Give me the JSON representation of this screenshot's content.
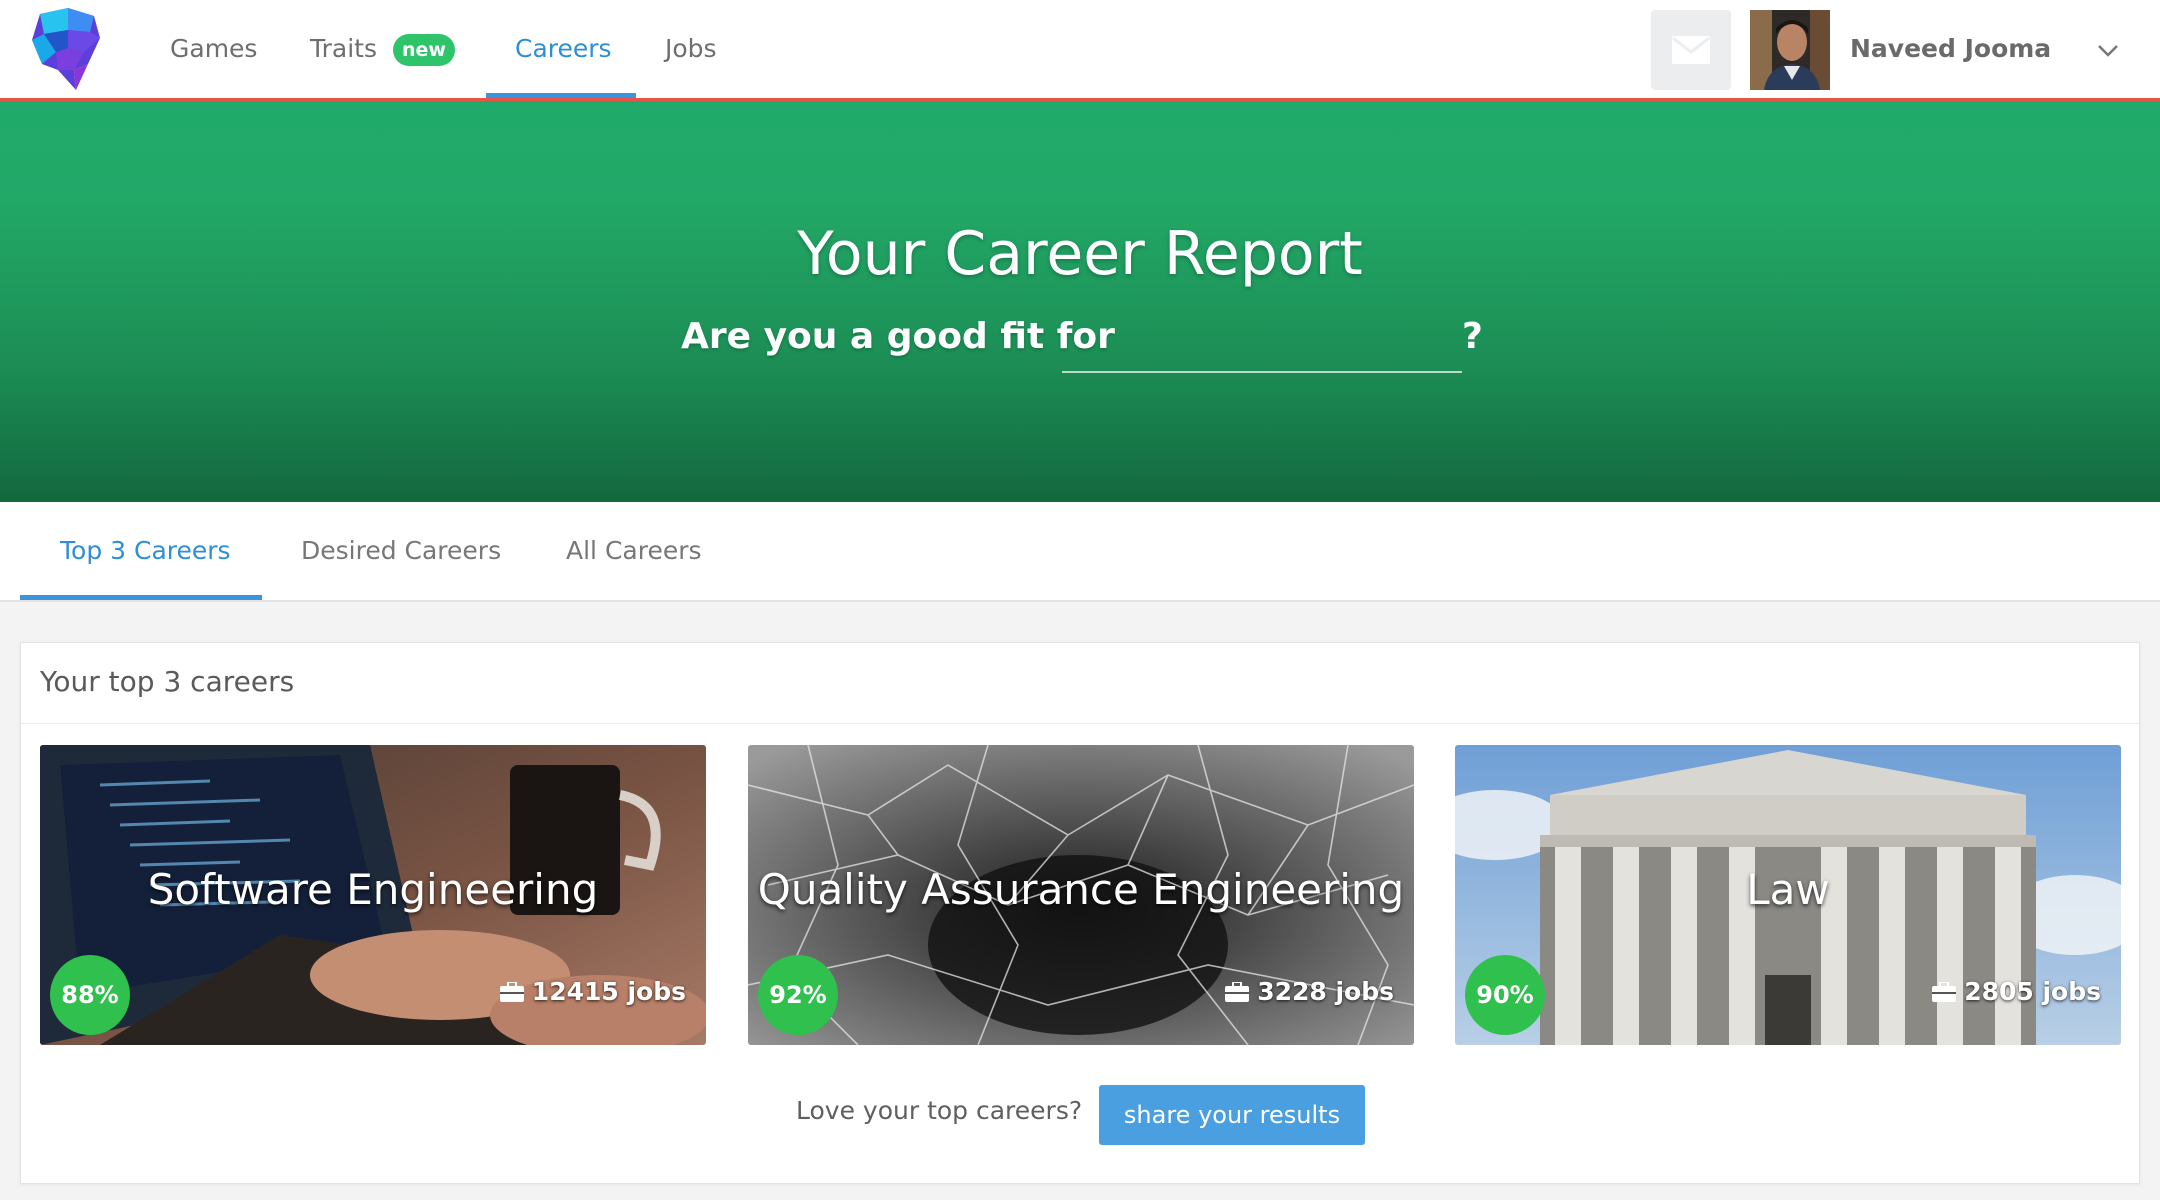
{
  "nav": {
    "logo_icon": "brain-logo-icon",
    "items": [
      {
        "label": "Games"
      },
      {
        "label": "Traits",
        "badge": "new"
      },
      {
        "label": "Careers",
        "active": true
      },
      {
        "label": "Jobs"
      }
    ],
    "mail_icon": "envelope-icon",
    "user_name": "Naveed Jooma",
    "user_menu_icon": "chevron-down-icon"
  },
  "hero": {
    "title": "Your Career Report",
    "question": "Are you a good fit for",
    "input_value": "",
    "question_end": "?"
  },
  "tabs": [
    {
      "label": "Top 3 Careers",
      "active": true
    },
    {
      "label": "Desired Careers"
    },
    {
      "label": "All Careers"
    }
  ],
  "panel": {
    "title": "Your top 3 careers",
    "cards": [
      {
        "title": "Software Engineering",
        "score": "88%",
        "jobs": "12415 jobs"
      },
      {
        "title": "Quality Assurance Engineering",
        "score": "92%",
        "jobs": "3228 jobs"
      },
      {
        "title": "Law",
        "score": "90%",
        "jobs": "2805 jobs"
      }
    ],
    "share_text": "Love your top careers?",
    "share_button": "share your results"
  },
  "colors": {
    "accent_blue": "#3b94d9",
    "hero_green": "#20ab6b",
    "score_green": "#2fc04d",
    "nav_border": "#e9534a"
  }
}
